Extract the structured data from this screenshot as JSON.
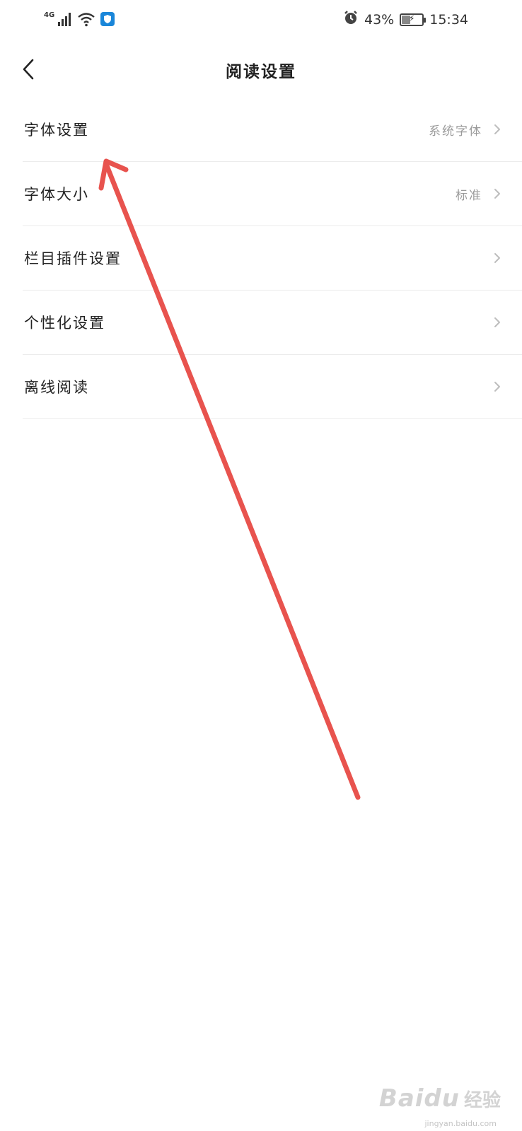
{
  "status_bar": {
    "network": "4G",
    "battery_percent": "43%",
    "battery_level": 0.43,
    "time": "15:34",
    "icons": [
      "signal-icon",
      "wifi-icon",
      "shield-app-icon",
      "alarm-icon",
      "battery-icon"
    ]
  },
  "header": {
    "title": "阅读设置",
    "back_icon": "chevron-left-icon"
  },
  "settings": {
    "items": [
      {
        "label": "字体设置",
        "value": "系统字体"
      },
      {
        "label": "字体大小",
        "value": "标准"
      },
      {
        "label": "栏目插件设置",
        "value": ""
      },
      {
        "label": "个性化设置",
        "value": ""
      },
      {
        "label": "离线阅读",
        "value": ""
      }
    ]
  },
  "annotation": {
    "color": "#e8534e"
  },
  "watermark": {
    "brand": "Baidu",
    "text": "经验",
    "url": "jingyan.baidu.com"
  },
  "colors": {
    "shield_app": "#1a86d9",
    "chevron": "#bdbdbd",
    "value_text": "#9a9a9a"
  }
}
